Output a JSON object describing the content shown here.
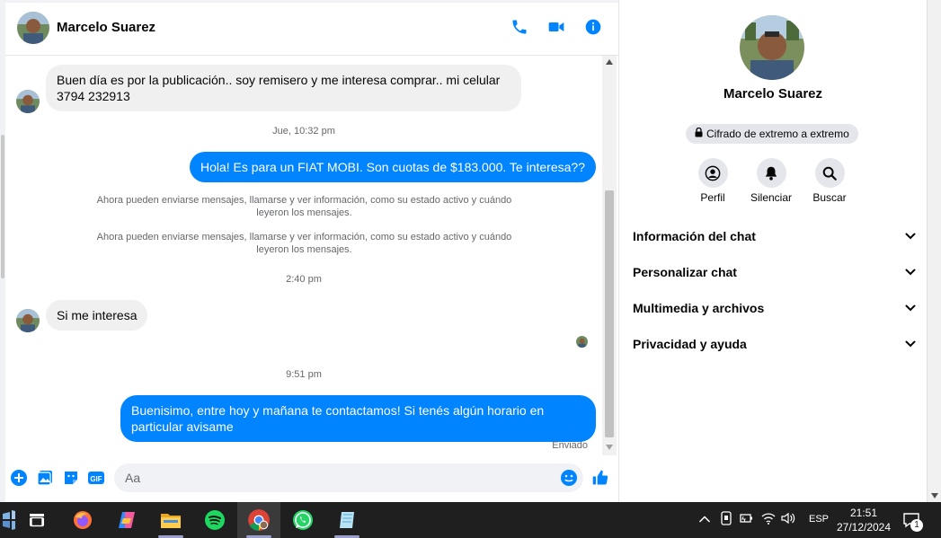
{
  "contact": {
    "name": "Marcelo Suarez"
  },
  "header": {
    "icons": [
      "phone-icon",
      "video-camera-icon",
      "info-icon"
    ]
  },
  "messages": {
    "incoming_1": "Buen día es por la publicación.. soy remisero y me interesa comprar.. mi celular 3794 232913",
    "timestamp_1": "Jue, 10:32 pm",
    "outgoing_1": "Hola! Es para un FIAT MOBI. Son cuotas de $183.000. Te interesa??",
    "system_1": "Ahora pueden enviarse mensajes, llamarse y ver información, como su estado activo y cuándo leyeron los mensajes.",
    "system_2": "Ahora pueden enviarse mensajes, llamarse y ver información, como su estado activo y cuándo leyeron los mensajes.",
    "timestamp_2": "2:40 pm",
    "incoming_2": "Si me interesa",
    "timestamp_3": "9:51 pm",
    "outgoing_2": "Buenisimo, entre hoy y mañana te contactamos! Si tenés algún horario en particular avisame",
    "status": "Enviado"
  },
  "composer": {
    "placeholder": "Aa"
  },
  "panel": {
    "name": "Marcelo Suarez",
    "encryption": "Cifrado de extremo a extremo",
    "actions": [
      {
        "label": "Perfil",
        "icon": "profile-icon"
      },
      {
        "label": "Silenciar",
        "icon": "bell-icon"
      },
      {
        "label": "Buscar",
        "icon": "search-icon"
      }
    ],
    "sections": [
      {
        "label": "Información del chat"
      },
      {
        "label": "Personalizar chat"
      },
      {
        "label": "Multimedia y archivos"
      },
      {
        "label": "Privacidad y ayuda"
      }
    ]
  },
  "taskbar": {
    "language": "ESP",
    "time": "21:51",
    "date": "27/12/2024",
    "notification_count": "1"
  },
  "colors": {
    "accent": "#0084ff",
    "bubble_in": "#f0f0f0",
    "taskbar": "#1f1f1f"
  }
}
